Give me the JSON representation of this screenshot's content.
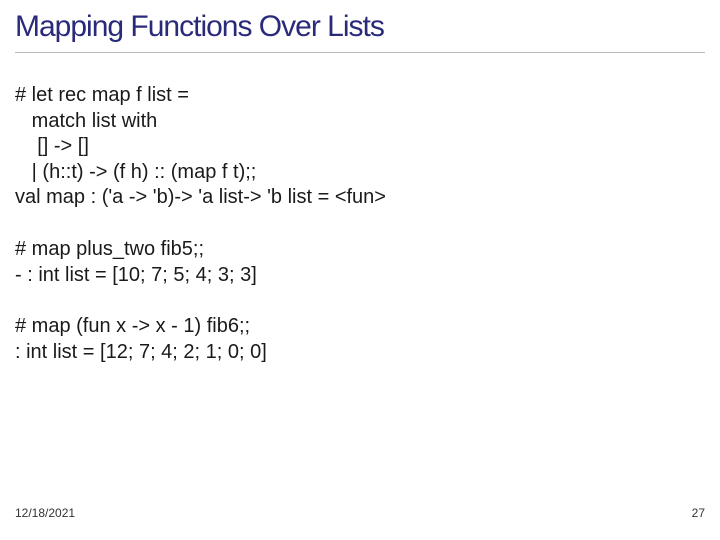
{
  "title": "Mapping Functions Over Lists",
  "code_block_1": "# let rec map f list =\n   match list with\n    [] -> []\n   | (h::t) -> (f h) :: (map f t);;\nval map : ('a -> 'b)-> 'a list-> 'b list = <fun>",
  "code_block_2": "# map plus_two fib5;;\n- : int list = [10; 7; 5; 4; 3; 3]",
  "code_block_3": "# map (fun x -> x - 1) fib6;;\n: int list = [12; 7; 4; 2; 1; 0; 0]",
  "footer_date": "12/18/2021",
  "footer_page": "27"
}
